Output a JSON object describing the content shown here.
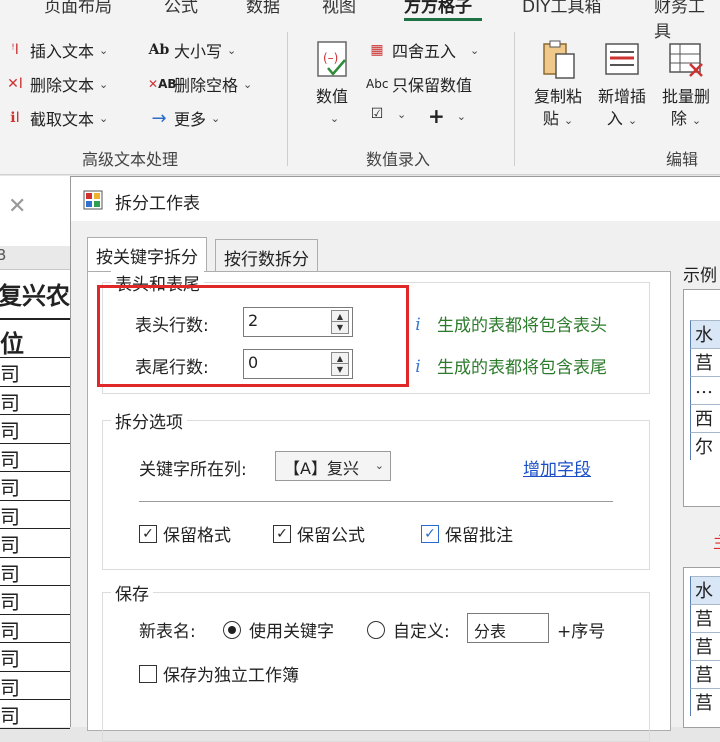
{
  "ribbon": {
    "tabs": [
      "页面布局",
      "公式",
      "数据",
      "视图",
      "方方格子",
      "DIY工具箱",
      "财务工具"
    ],
    "active_tab": "方方格子",
    "text_group": {
      "insert": "插入文本",
      "delete": "删除文本",
      "cut": "截取文本",
      "case": "大小写",
      "del_space": "删除空格",
      "more": "更多",
      "label": "高级文本处理"
    },
    "number_group": {
      "value_btn": "数值",
      "round": "四舍五入",
      "keep_value": "只保留数值",
      "label": "数值录入"
    },
    "edit_group": {
      "copy_paste": [
        "复制粘",
        "贴"
      ],
      "add_insert": [
        "新增插",
        "入"
      ],
      "batch_delete": [
        "批量删",
        "除"
      ],
      "label": "编辑"
    }
  },
  "sheet": {
    "column": "B",
    "title": "复兴农",
    "header": "位",
    "rows": [
      "司",
      "司",
      "司",
      "司",
      "司",
      "司",
      "司",
      "司",
      "司",
      "司",
      "司",
      "司",
      "司"
    ]
  },
  "dialog": {
    "title": "拆分工作表",
    "tabs": [
      "按关键字拆分",
      "按行数拆分"
    ],
    "header_footer": {
      "legend": "表头和表尾",
      "header_rows_label": "表头行数:",
      "header_rows_value": "2",
      "footer_rows_label": "表尾行数:",
      "footer_rows_value": "0",
      "header_hint": "生成的表都将包含表头",
      "footer_hint": "生成的表都将包含表尾"
    },
    "split_options": {
      "legend": "拆分选项",
      "key_column_label": "关键字所在列:",
      "key_column_value": "【A】复兴",
      "add_field": "增加字段",
      "keep_format": "保留格式",
      "keep_formula": "保留公式",
      "keep_comment": "保留批注"
    },
    "save": {
      "legend": "保存",
      "new_name_label": "新表名:",
      "use_keyword": "使用关键字",
      "custom": "自定义:",
      "custom_value": "分表",
      "suffix": "+序号",
      "save_standalone": "保存为独立工作簿"
    },
    "example": {
      "label": "示例",
      "top_cells": [
        "水",
        "莒",
        "…",
        "西",
        "尔"
      ],
      "bottom_cells": [
        "水",
        "莒",
        "莒",
        "莒",
        "莒"
      ],
      "red_mark": "主"
    }
  },
  "colors": {
    "accent_green": "#1e7145",
    "hint_green": "#2c7a2c",
    "link_blue": "#1a4fc7",
    "highlight_red": "#e02828"
  }
}
